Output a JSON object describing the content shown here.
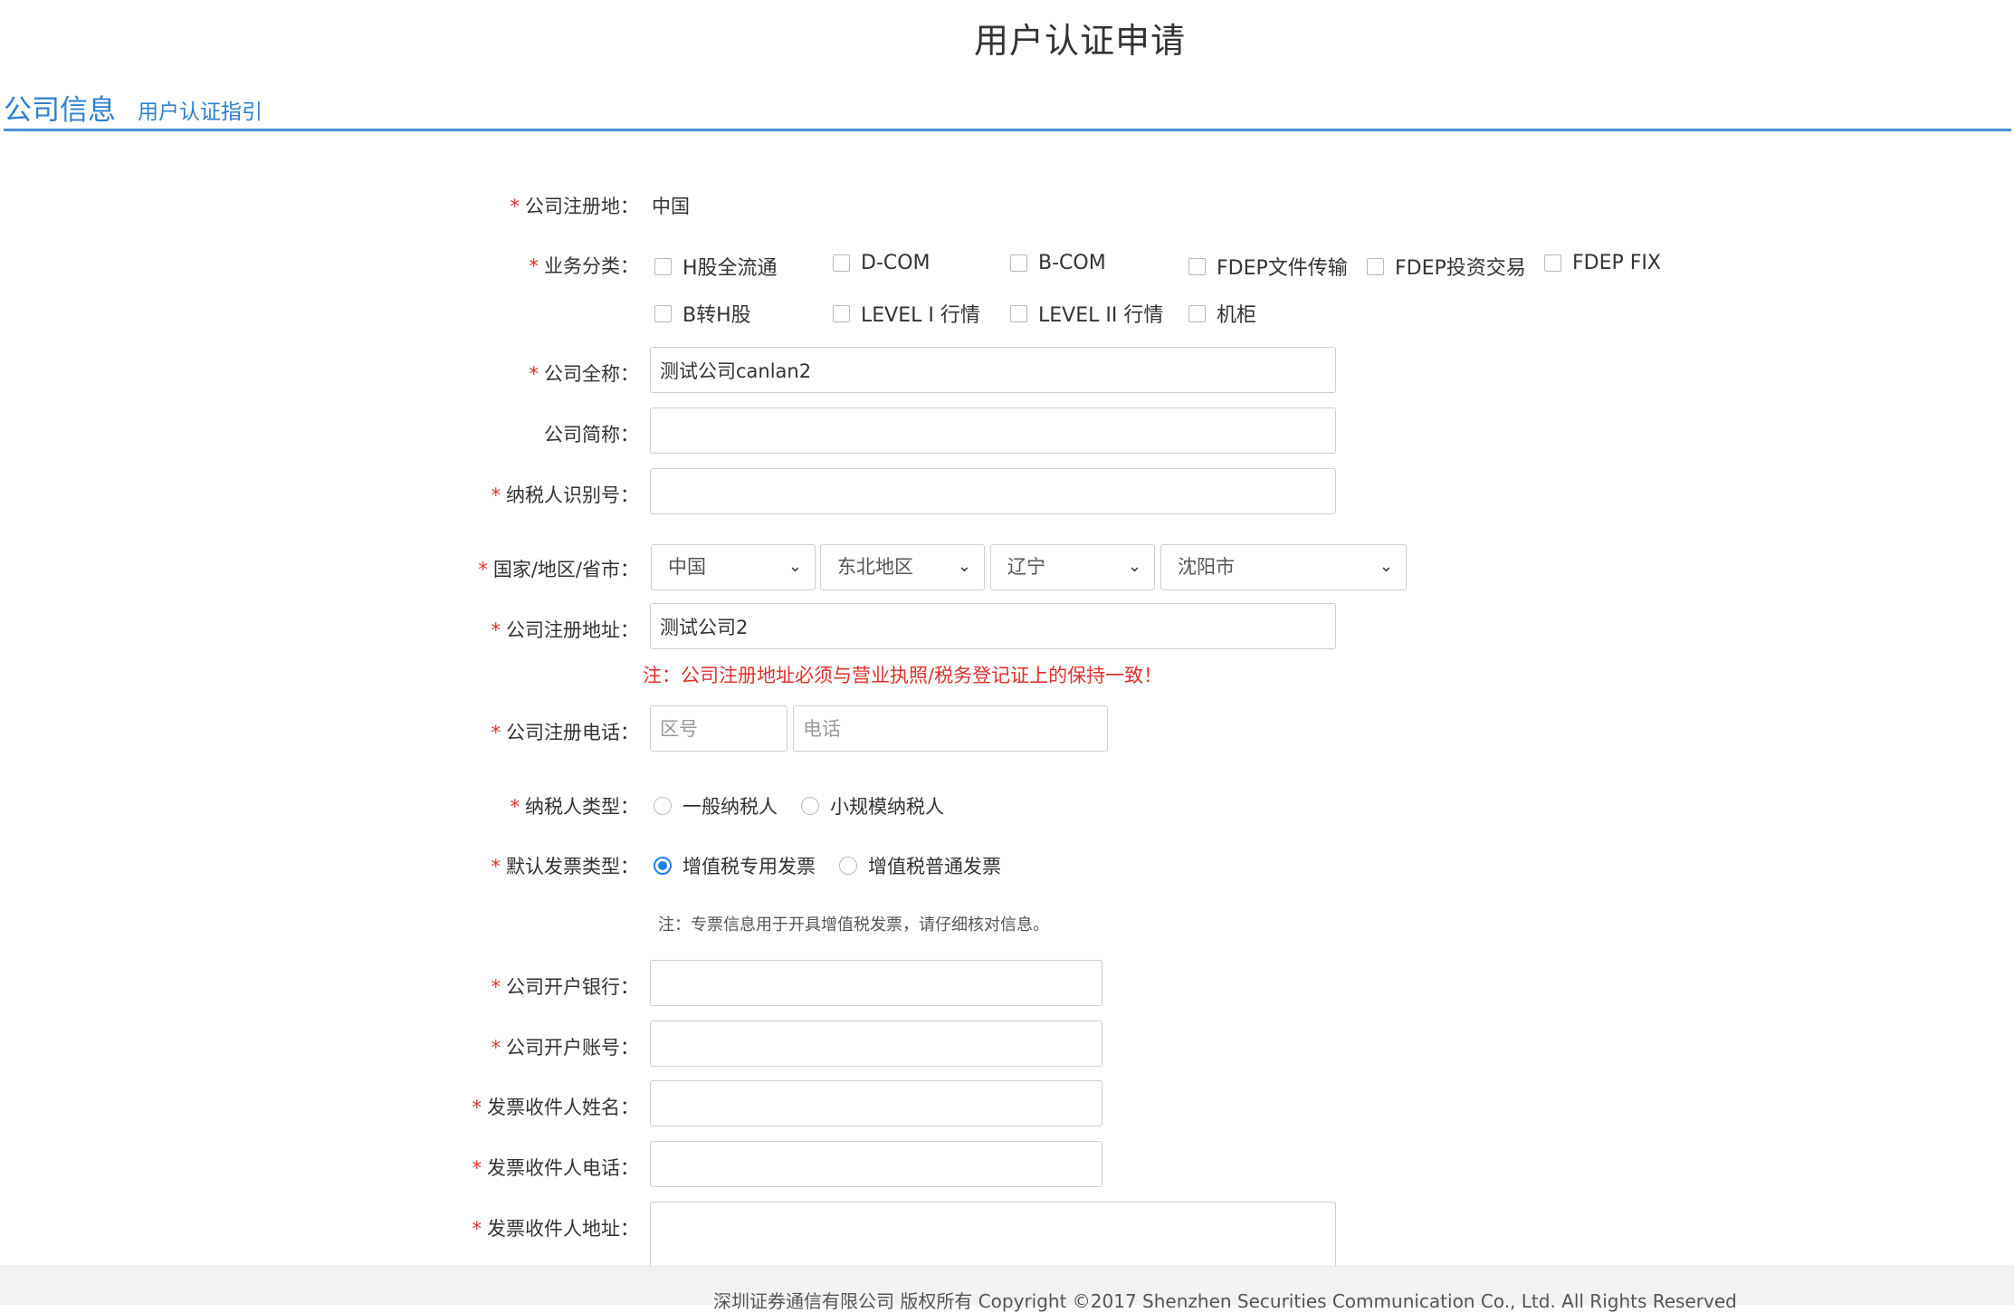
{
  "page": {
    "title": "用户认证申请"
  },
  "tabs": {
    "company_info": "公司信息",
    "guide": "用户认证指引"
  },
  "form": {
    "reg_place": {
      "label": "公司注册地：",
      "value": "中国"
    },
    "biz_category": {
      "label": "业务分类：",
      "options": [
        "H股全流通",
        "D-COM",
        "B-COM",
        "FDEP文件传输",
        "FDEP投资交易",
        "FDEP FIX",
        "B转H股",
        "LEVEL I 行情",
        "LEVEL II 行情",
        "机柜"
      ]
    },
    "full_name": {
      "label": "公司全称：",
      "value": "测试公司canlan2"
    },
    "short_name": {
      "label": "公司简称：",
      "value": ""
    },
    "taxpayer_id": {
      "label": "纳税人识别号：",
      "value": ""
    },
    "region": {
      "label": "国家/地区/省市：",
      "country": "中国",
      "area": "东北地区",
      "province": "辽宁",
      "city": "沈阳市"
    },
    "reg_address": {
      "label": "公司注册地址：",
      "value": "测试公司2",
      "note": "注：公司注册地址必须与营业执照/税务登记证上的保持一致！"
    },
    "reg_phone": {
      "label": "公司注册电话：",
      "area_placeholder": "区号",
      "phone_placeholder": "电话"
    },
    "taxpayer_type": {
      "label": "纳税人类型：",
      "options": [
        "一般纳税人",
        "小规模纳税人"
      ],
      "selected": ""
    },
    "invoice_type": {
      "label": "默认发票类型：",
      "options": [
        "增值税专用发票",
        "增值税普通发票"
      ],
      "selected": "增值税专用发票",
      "note": "注：专票信息用于开具增值税发票，请仔细核对信息。"
    },
    "bank": {
      "label": "公司开户银行：",
      "value": ""
    },
    "account": {
      "label": "公司开户账号：",
      "value": ""
    },
    "receiver_name": {
      "label": "发票收件人姓名：",
      "value": ""
    },
    "receiver_phone": {
      "label": "发票收件人电话：",
      "value": ""
    },
    "receiver_address": {
      "label": "发票收件人地址：",
      "value": ""
    },
    "required_mark": "*"
  },
  "footer": {
    "text": "深圳证券通信有限公司 版权所有 Copyright ©2017 Shenzhen Securities Communication Co., Ltd. All Rights Reserved"
  },
  "colors": {
    "accent": "#2f7fd1",
    "required": "#e0312d",
    "radio_on": "#1e7fe6"
  }
}
